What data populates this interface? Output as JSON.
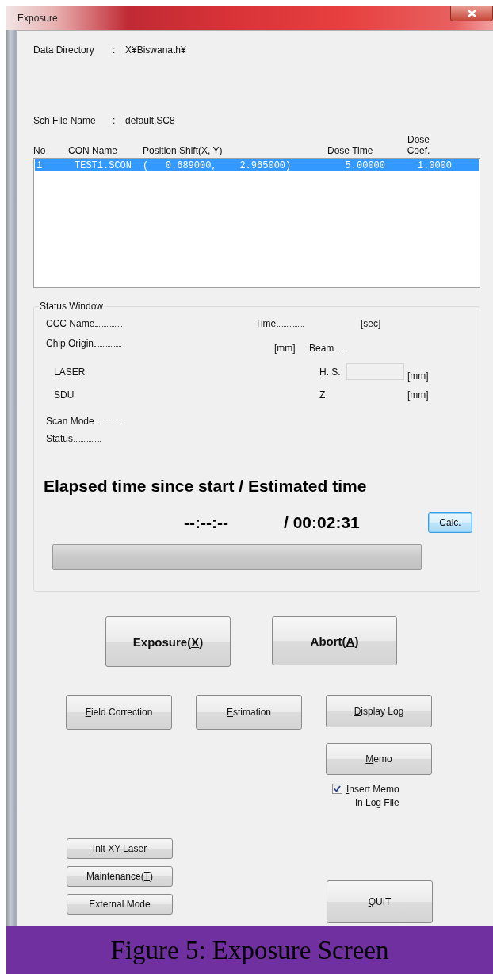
{
  "window": {
    "title": "Exposure"
  },
  "data_directory": {
    "label": "Data Directory",
    "separator": ":",
    "value": "X¥Biswanath¥"
  },
  "sch_file": {
    "label": "Sch File Name",
    "separator": ":",
    "value": "default.SC8"
  },
  "table": {
    "columns": [
      "No",
      "CON Name",
      "Position Shift(X, Y)",
      "Dose Time",
      "Dose Coef."
    ],
    "rows": [
      {
        "cells": [
          "1",
          "TEST1.SCON",
          "(   0.689000,    2.965000)",
          "5.00000",
          "1.0000"
        ],
        "selected": true
      }
    ]
  },
  "status_window": {
    "title": "Status Window",
    "ccc_name": "CCC Name",
    "time": "Time",
    "time_unit": "[sec]",
    "chip_origin": "Chip Origin",
    "chip_unit": "[mm]",
    "beam": "Beam",
    "laser": "LASER",
    "hs": "H. S.",
    "hs_unit": "[mm]",
    "sdu": "SDU",
    "z": "Z",
    "z_unit": "[mm]",
    "scan_mode": "Scan Mode",
    "status": "Status",
    "heading": "Elapsed time since start / Estimated time",
    "elapsed": "--:--:--",
    "estimated": "/ 00:02:31",
    "calc_button": {
      "label": "Calc.",
      "default": true
    },
    "progress": {
      "level": 0
    }
  },
  "buttons": {
    "exposure": {
      "before": "Exposure(",
      "key": "X",
      "after": ")"
    },
    "abort": {
      "before": "Abort(",
      "key": "A",
      "after": ")"
    },
    "field_correction": {
      "key": "F",
      "after": "ield Correction"
    },
    "estimation": {
      "key": "E",
      "after": "stimation"
    },
    "display_log": {
      "key": "D",
      "after": "isplay Log"
    },
    "memo": {
      "key": "M",
      "after": "emo"
    },
    "init_xy_laser": {
      "key": "I",
      "after": "nit XY-Laser"
    },
    "maintenance": {
      "before": "Maintenance(",
      "key": "T",
      "after": ")"
    },
    "external_mode": {
      "after": "External Mode"
    },
    "quit": {
      "key": "Q",
      "after": "UIT"
    }
  },
  "insert_memo": {
    "checked": true,
    "key": "I",
    "after": "nsert Memo\nin Log File"
  },
  "caption": "Figure 5: Exposure Screen"
}
